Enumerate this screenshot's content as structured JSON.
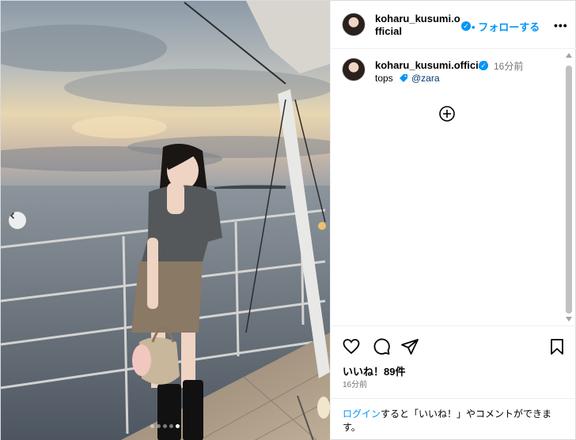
{
  "post": {
    "username": "koharu_kusumi.official",
    "follow_label": "フォローする",
    "follow_separator": "•",
    "more_label": "•••",
    "caption": {
      "username": "koharu_kusumi.official",
      "time": "16分前",
      "text": "tops",
      "mention": "@zara"
    },
    "likes": "いいね！89件",
    "time_ago": "16分前",
    "login_prompt": {
      "link": "ログイン",
      "rest": "すると「いいね！」やコメントができます。"
    },
    "carousel": {
      "count": 5,
      "active_index": 4
    }
  },
  "icons": {
    "verified": "verified-badge-icon",
    "prev": "chevron-left-icon",
    "tag": "tag-icon",
    "load_more": "plus-circle-icon",
    "like": "heart-icon",
    "comment": "comment-icon",
    "share": "paper-plane-icon",
    "save": "bookmark-icon"
  },
  "colors": {
    "accent": "#0095f6",
    "link_dark": "#00376b",
    "muted": "#737373"
  }
}
